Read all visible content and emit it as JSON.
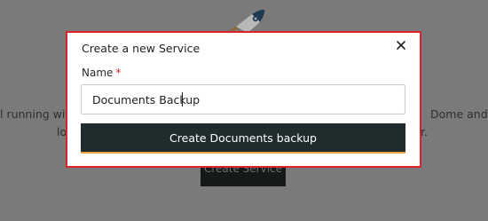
{
  "background": {
    "line1_left": "l running with",
    "line1_right": "Dome and ena",
    "line2_left": "lo",
    "line2_right": "r.",
    "create_service_label": "Create Service"
  },
  "modal": {
    "title": "Create a new Service",
    "close_icon": "close-icon",
    "name_label": "Name",
    "required_marker": "*",
    "name_value": "Documents Backup",
    "submit_label": "Create Documents backup"
  },
  "colors": {
    "modal_border": "#d9242c",
    "button_bg": "#1f2b2c",
    "button_accent": "#f0a340",
    "overlay": "#7a7a7a"
  }
}
